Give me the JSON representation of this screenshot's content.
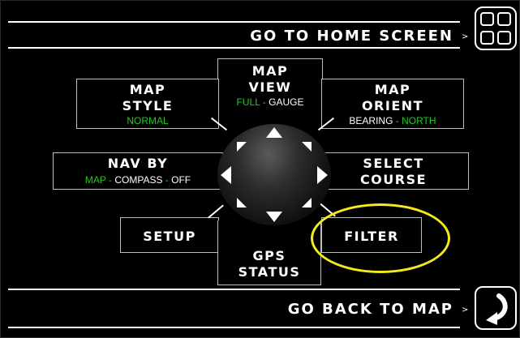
{
  "top_bar": {
    "label": "GO TO HOME SCREEN",
    "caret": ">",
    "icon": "grid-icon"
  },
  "bottom_bar": {
    "label": "GO BACK TO MAP",
    "caret": ">",
    "icon": "return-arrow-icon"
  },
  "menu": {
    "map_view": {
      "line1": "MAP",
      "line2": "VIEW",
      "opt1": "FULL",
      "sep": " - ",
      "opt2": "GAUGE"
    },
    "map_style": {
      "line1": "MAP",
      "line2": "STYLE",
      "value": "NORMAL"
    },
    "map_orient": {
      "line1": "MAP",
      "line2": "ORIENT",
      "opt1": "BEARING",
      "sep": " - ",
      "opt2": "NORTH"
    },
    "nav_by": {
      "label": "NAV BY",
      "opt1": "MAP",
      "sep1": " - ",
      "opt2": "COMPASS",
      "sep2": " - ",
      "opt3": "OFF"
    },
    "select_course": {
      "line1": "SELECT",
      "line2": "COURSE"
    },
    "setup": {
      "label": "SETUP"
    },
    "gps_status": {
      "line1": "GPS",
      "line2": "STATUS"
    },
    "filter": {
      "label": "FILTER"
    }
  },
  "highlight_color": "#f5ea1c",
  "accent_green": "#22c91f"
}
